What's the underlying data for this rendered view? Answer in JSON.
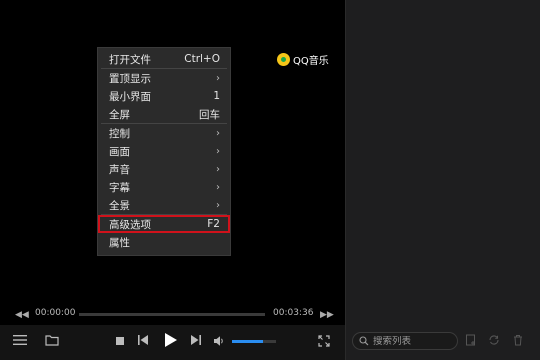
{
  "brand": {
    "logo_text": "QQ音乐",
    "logo_color": "#f5c518",
    "logo_accent": "#1aa64a"
  },
  "context_menu": {
    "items": [
      {
        "label": "打开文件",
        "shortcut": "Ctrl+O",
        "submenu": false
      },
      {
        "label": "置顶显示",
        "shortcut": "",
        "submenu": true
      },
      {
        "label": "最小界面",
        "shortcut": "1",
        "submenu": false
      },
      {
        "label": "全屏",
        "shortcut": "回车",
        "submenu": false
      },
      {
        "label": "控制",
        "shortcut": "",
        "submenu": true
      },
      {
        "label": "画面",
        "shortcut": "",
        "submenu": true
      },
      {
        "label": "声音",
        "shortcut": "",
        "submenu": true
      },
      {
        "label": "字幕",
        "shortcut": "",
        "submenu": true
      },
      {
        "label": "全景",
        "shortcut": "",
        "submenu": true
      },
      {
        "label": "高级选项",
        "shortcut": "F2",
        "submenu": false,
        "highlighted": true
      },
      {
        "label": "属性",
        "shortcut": "",
        "submenu": false
      }
    ],
    "highlight_color": "#d0121b"
  },
  "player": {
    "current_time": "00:00:00",
    "total_time": "00:03:36",
    "seek_progress": 0,
    "volume_level": 0.7,
    "accent_color": "#2a8df0"
  },
  "playlist": {
    "search_placeholder": "搜索列表"
  }
}
